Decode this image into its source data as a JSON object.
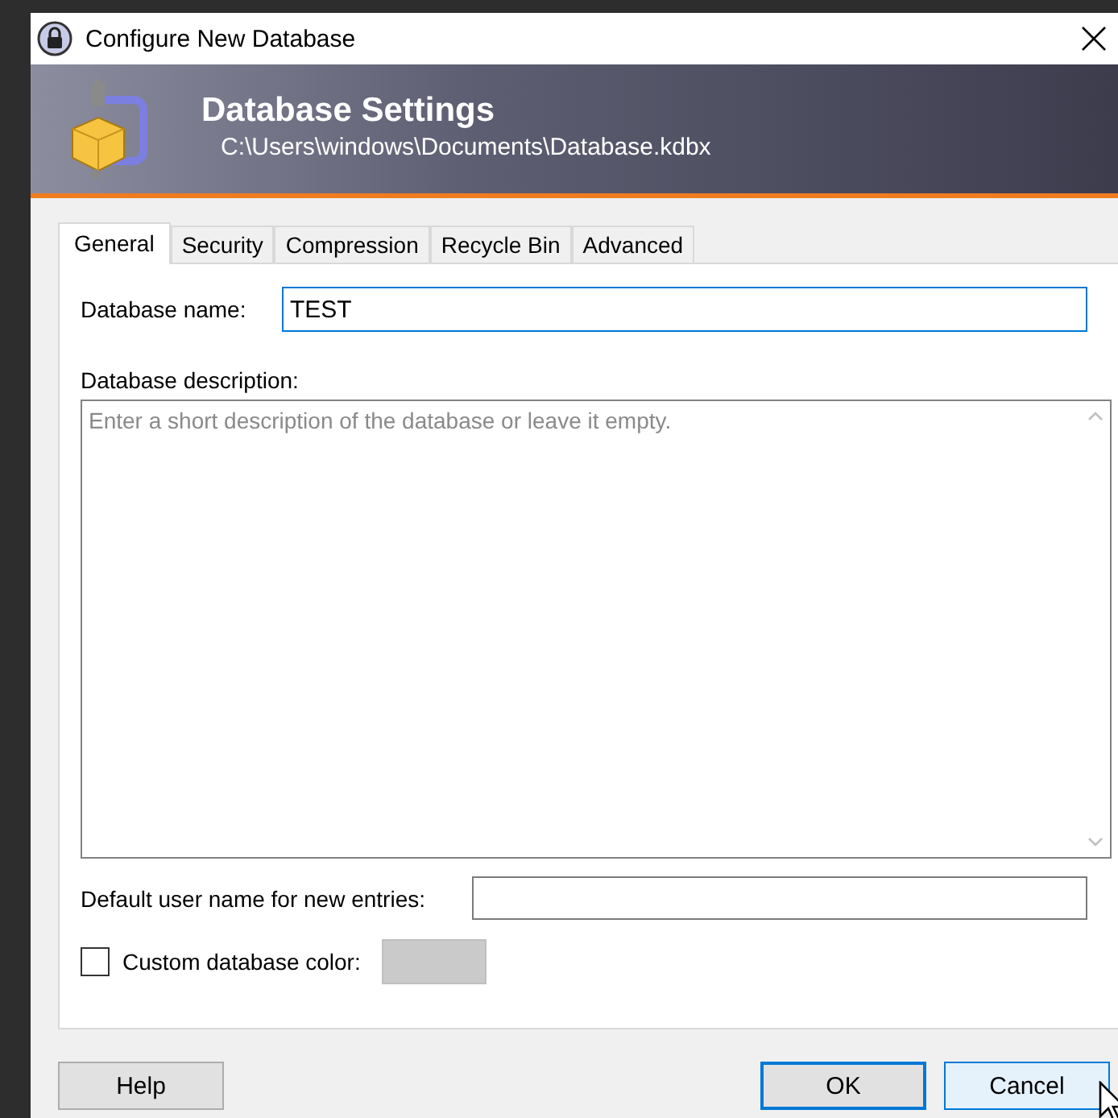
{
  "window": {
    "title": "Configure New Database"
  },
  "banner": {
    "title": "Database Settings",
    "subtitle": "C:\\Users\\windows\\Documents\\Database.kdbx"
  },
  "tabs": [
    {
      "label": "General",
      "selected": true
    },
    {
      "label": "Security",
      "selected": false
    },
    {
      "label": "Compression",
      "selected": false
    },
    {
      "label": "Recycle Bin",
      "selected": false
    },
    {
      "label": "Advanced",
      "selected": false
    }
  ],
  "name_field": {
    "label": "Database name:",
    "value": "TEST",
    "focused": true
  },
  "description_field": {
    "label": "Database description:",
    "placeholder": "Enter a short description of the database or leave it empty."
  },
  "username_field": {
    "label": "Default user name for new entries:"
  },
  "custom_color": {
    "label": "Custom database color:",
    "checked": false
  },
  "buttons": [
    {
      "label": "Help",
      "default": false,
      "hovered": false
    },
    {
      "label": "OK",
      "default": true,
      "hovered": false
    },
    {
      "label": "Cancel",
      "default": false,
      "hovered": true
    }
  ]
}
